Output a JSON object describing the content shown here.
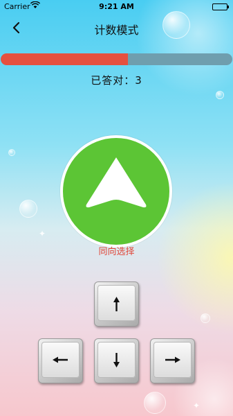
{
  "status_bar": {
    "carrier": "Carrier",
    "time": "9:21 AM"
  },
  "nav": {
    "title": "计数模式",
    "back_icon": "chevron-left-icon"
  },
  "progress": {
    "fraction": 0.55,
    "fill_color": "#e5503f",
    "track_color": "#6f9eae"
  },
  "score": {
    "text": "已答对：3"
  },
  "prompt": {
    "direction": "up",
    "circle_color": "#5cc535",
    "icon": "arrow-up-icon"
  },
  "mode_label": "同向选择",
  "keys": [
    {
      "direction": "up",
      "icon": "arrow-up-icon"
    },
    {
      "direction": "left",
      "icon": "arrow-left-icon"
    },
    {
      "direction": "down",
      "icon": "arrow-down-icon"
    },
    {
      "direction": "right",
      "icon": "arrow-right-icon"
    }
  ]
}
